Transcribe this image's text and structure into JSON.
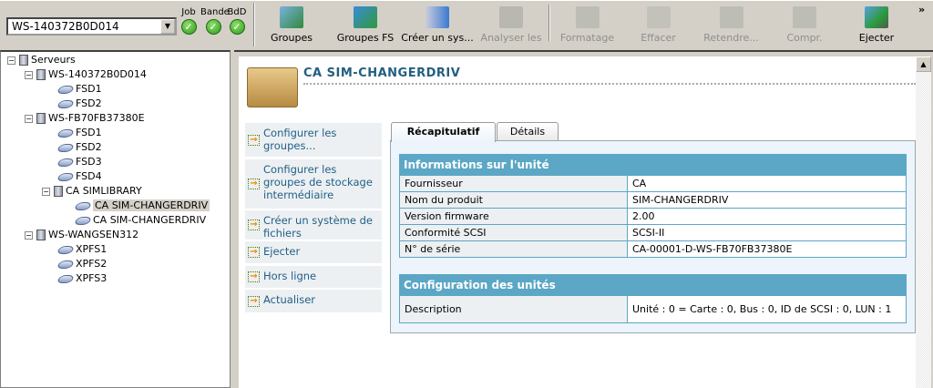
{
  "toolbar": {
    "server_select": "WS-140372B0D014",
    "status": [
      {
        "label": "Job",
        "state": "ok"
      },
      {
        "label": "Bande",
        "state": "ok"
      },
      {
        "label": "BdD",
        "state": "ok"
      }
    ],
    "buttons": [
      {
        "label": "Groupes",
        "enabled": true
      },
      {
        "label": "Groupes FS",
        "enabled": true
      },
      {
        "label": "Créer un sys...",
        "enabled": true
      },
      {
        "label": "Analyser les ...",
        "enabled": false
      },
      {
        "label": "Formatage",
        "enabled": false
      },
      {
        "label": "Effacer",
        "enabled": false
      },
      {
        "label": "Retendre...",
        "enabled": false
      },
      {
        "label": "Compr.",
        "enabled": false
      },
      {
        "label": "Ejecter",
        "enabled": true
      }
    ],
    "overflow": "»"
  },
  "tree": [
    {
      "label": "Serveurs",
      "type": "root"
    },
    {
      "label": "WS-140372B0D014",
      "type": "server"
    },
    {
      "label": "FSD1",
      "type": "disk"
    },
    {
      "label": "FSD2",
      "type": "disk"
    },
    {
      "label": "WS-FB70FB37380E",
      "type": "server"
    },
    {
      "label": "FSD1",
      "type": "disk"
    },
    {
      "label": "FSD2",
      "type": "disk"
    },
    {
      "label": "FSD3",
      "type": "disk"
    },
    {
      "label": "FSD4",
      "type": "disk"
    },
    {
      "label": "CA SIMLIBRARY",
      "type": "library"
    },
    {
      "label": "CA SIM-CHANGERDRIV",
      "type": "drive",
      "selected": true
    },
    {
      "label": "CA SIM-CHANGERDRIV",
      "type": "drive"
    },
    {
      "label": "WS-WANGSEN312",
      "type": "server"
    },
    {
      "label": "XPFS1",
      "type": "disk"
    },
    {
      "label": "XPFS2",
      "type": "disk"
    },
    {
      "label": "XPFS3",
      "type": "disk"
    }
  ],
  "main": {
    "title": "CA SIM-CHANGERDRIV",
    "actions": [
      "Configurer les groupes...",
      "Configurer les groupes de stockage intermédiaire",
      "Créer un système de fichiers",
      "Ejecter",
      "Hors ligne",
      "Actualiser"
    ],
    "tabs": [
      {
        "label": "Récapitulatif",
        "active": true
      },
      {
        "label": "Détails",
        "active": false
      }
    ],
    "info": {
      "header": "Informations sur l'unité",
      "rows": [
        [
          "Fournisseur",
          "CA"
        ],
        [
          "Nom du produit",
          "SIM-CHANGERDRIV"
        ],
        [
          "Version firmware",
          "2.00"
        ],
        [
          "Conformité SCSI",
          "SCSI-II"
        ],
        [
          "N° de série",
          "CA-00001-D-WS-FB70FB37380E"
        ]
      ]
    },
    "config": {
      "header": "Configuration des unités",
      "rows": [
        [
          "Description",
          "Unité : 0 = Carte : 0, Bus : 0, ID de SCSI : 0, LUN : 1"
        ]
      ]
    }
  },
  "colors": {
    "table_header": "#5ba7c5",
    "title": "#235f80",
    "link": "#1f5f88"
  }
}
